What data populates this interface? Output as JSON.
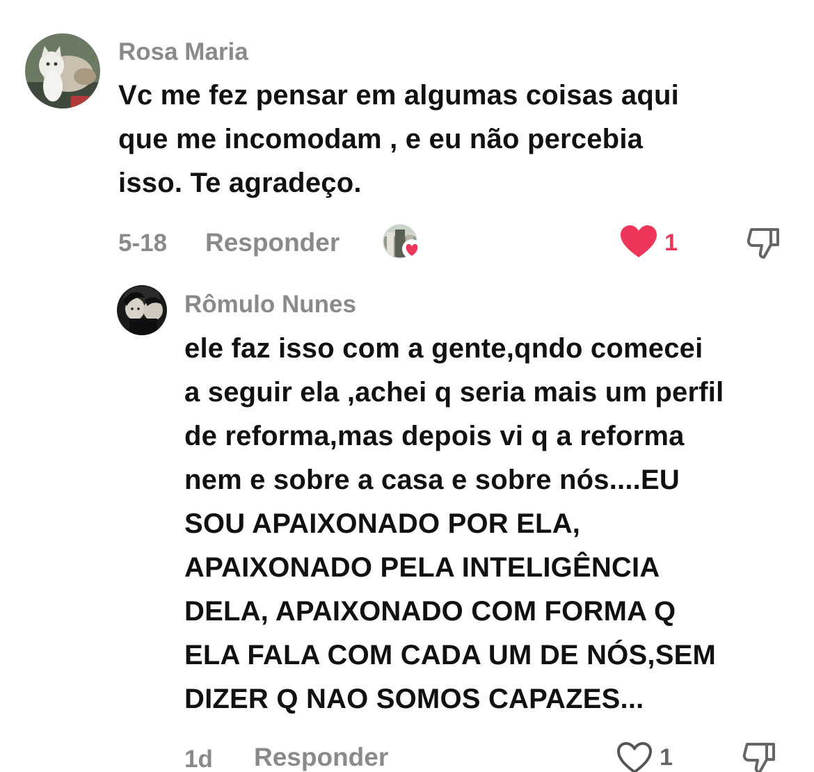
{
  "comments": [
    {
      "author": "Rosa Maria",
      "avatar_icon": "cat-photo-avatar",
      "text": "Vc me fez pensar em algumas coisas aqui\nque me incomodam , e eu não percebia\nisso. Te agradeço.",
      "timestamp": "5-18",
      "reply_label": "Responder",
      "creator_liked_icon": "creator-heart-avatar",
      "like_icon": "heart-filled-icon",
      "like_count": "1",
      "liked": true,
      "dislike_icon": "thumbs-down-icon"
    },
    {
      "author": "Rômulo Nunes",
      "avatar_icon": "person-photo-avatar",
      "text": "ele faz isso com a gente,qndo comecei\na seguir ela ,achei q seria mais um perfil\nde reforma,mas depois vi q a reforma\nnem e sobre a casa e sobre nós....EU\nSOU APAIXONADO POR ELA,\nAPAIXONADO PELA INTELIGÊNCIA\nDELA, APAIXONADO COM FORMA Q\nELA FALA COM CADA UM DE NÓS,SEM\nDIZER Q NAO SOMOS CAPAZES...",
      "timestamp": "1d",
      "reply_label": "Responder",
      "like_icon": "heart-outline-icon",
      "like_count": "1",
      "liked": false,
      "dislike_icon": "thumbs-down-icon"
    }
  ],
  "colors": {
    "like_red": "#f0355a",
    "meta_gray": "#8a8a8a",
    "text_dark": "#111111"
  }
}
